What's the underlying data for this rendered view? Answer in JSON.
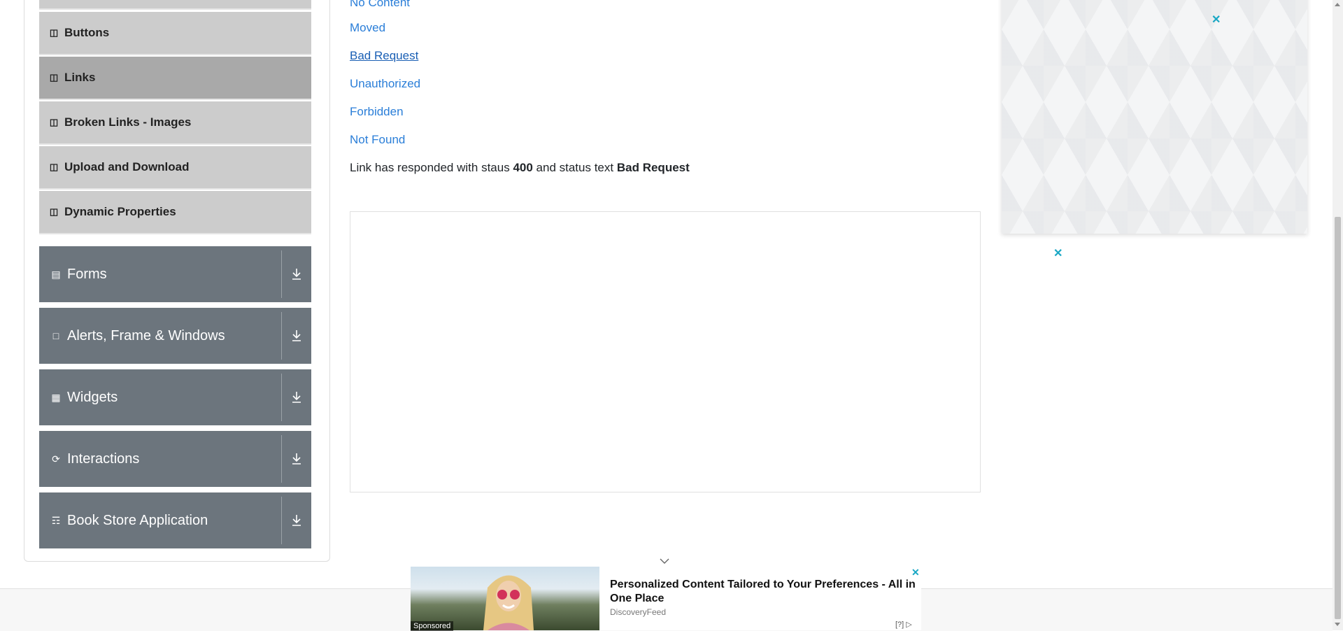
{
  "sidebar": {
    "sub_items": [
      {
        "label": "Buttons",
        "icon": "html5-icon"
      },
      {
        "label": "Links",
        "icon": "html5-icon",
        "active": true
      },
      {
        "label": "Broken Links - Images",
        "icon": "html5-icon"
      },
      {
        "label": "Upload and Download",
        "icon": "html5-icon"
      },
      {
        "label": "Dynamic Properties",
        "icon": "html5-icon"
      }
    ],
    "groups": [
      {
        "label": "Forms",
        "icon": "form-icon"
      },
      {
        "label": "Alerts, Frame & Windows",
        "icon": "window-icon"
      },
      {
        "label": "Widgets",
        "icon": "widgets-icon"
      },
      {
        "label": "Interactions",
        "icon": "interactions-icon"
      },
      {
        "label": "Book Store Application",
        "icon": "book-icon"
      }
    ]
  },
  "main": {
    "links": [
      "No Content",
      "Moved",
      "Bad Request",
      "Unauthorized",
      "Forbidden",
      "Not Found"
    ],
    "response": {
      "prefix": "Link has responded with staus",
      "status_code": "400",
      "middle": "and status text",
      "status_text": "Bad Request"
    }
  },
  "ads": {
    "close_symbol": "✕",
    "bottom": {
      "title": "Personalized Content Tailored to Your Preferences - All in One Place",
      "source": "DiscoveryFeed",
      "sponsored": "Sponsored",
      "adchoices": "[?]"
    }
  },
  "colors": {
    "link": "#2a7ed8",
    "sidebar_group": "#6c757d",
    "sidebar_item": "#cccccc",
    "sidebar_item_active": "#a9a9a9",
    "close": "#19a7c4"
  }
}
